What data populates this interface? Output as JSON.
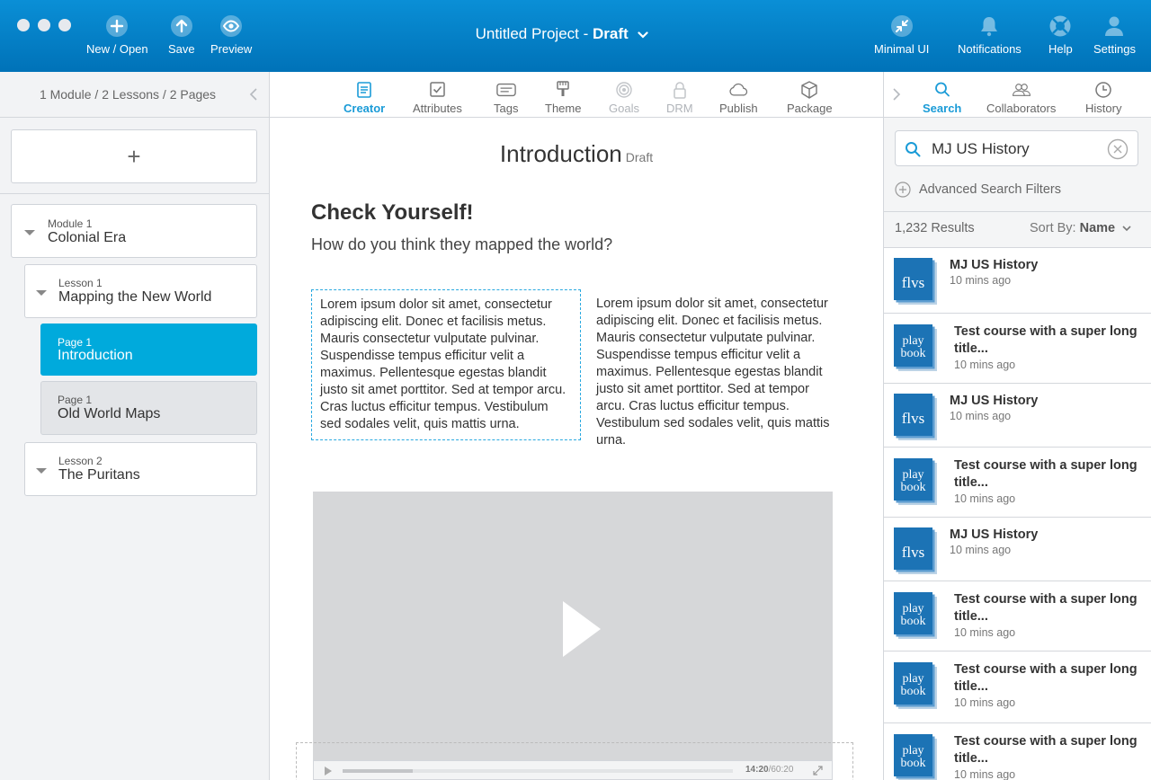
{
  "window": {
    "controls": [
      "close",
      "minimize",
      "maximize"
    ]
  },
  "toolbar": {
    "new_open": "New / Open",
    "save": "Save",
    "preview": "Preview",
    "project_name": "Untitled Project - ",
    "project_status": "Draft",
    "minimal_ui": "Minimal UI",
    "notifications": "Notifications",
    "help": "Help",
    "settings": "Settings"
  },
  "outline": {
    "summary": "1 Module / 2 Lessons / 2 Pages",
    "add_symbol": "+",
    "items": [
      {
        "sub": "Module 1",
        "title": "Colonial Era"
      },
      {
        "sub": "Lesson 1",
        "title": "Mapping the New World"
      },
      {
        "sub": "Page 1",
        "title": "Introduction"
      },
      {
        "sub": "Page 1",
        "title": "Old World Maps"
      },
      {
        "sub": "Lesson 2",
        "title": "The Puritans"
      }
    ]
  },
  "tabs": [
    {
      "label": "Creator",
      "icon": "creator-icon",
      "state": "active"
    },
    {
      "label": "Attributes",
      "icon": "checkbox-icon",
      "state": "normal"
    },
    {
      "label": "Tags",
      "icon": "tags-icon",
      "state": "normal"
    },
    {
      "label": "Theme",
      "icon": "paintbrush-icon",
      "state": "normal"
    },
    {
      "label": "Goals",
      "icon": "target-icon",
      "state": "disabled"
    },
    {
      "label": "DRM",
      "icon": "lock-icon",
      "state": "disabled"
    },
    {
      "label": "Publish",
      "icon": "cloud-icon",
      "state": "normal"
    },
    {
      "label": "Package",
      "icon": "box-icon",
      "state": "normal"
    }
  ],
  "editor": {
    "page_title": "Introduction",
    "page_status": "Draft",
    "heading": "Check Yourself!",
    "question": "How do you think they mapped the world?",
    "col1": "Lorem ipsum dolor sit amet, consectetur adipiscing elit. Donec et facilisis metus. Mauris consectetur vulputate pulvinar. Suspendisse tempus efficitur velit a maximus. Pellentesque egestas blandit justo sit amet porttitor. Sed at tempor arcu. Cras luctus efficitur tempus. Vestibulum sed sodales velit, quis mattis urna.",
    "col2": "Lorem ipsum dolor sit amet, consectetur adipiscing elit. Donec et facilisis metus. Mauris consectetur vulputate pulvinar. Suspendisse tempus efficitur velit a maximus. Pellentesque egestas blandit justo sit amet porttitor. Sed at tempor arcu. Cras luctus efficitur tempus. Vestibulum sed sodales velit, quis mattis urna.",
    "video": {
      "current": "14:20",
      "total": "/60:20",
      "progress": 0.18
    }
  },
  "right_tabs": [
    {
      "label": "Search",
      "icon": "search-icon",
      "state": "active"
    },
    {
      "label": "Collaborators",
      "icon": "people-icon",
      "state": "normal"
    },
    {
      "label": "History",
      "icon": "clock-icon",
      "state": "normal"
    }
  ],
  "search": {
    "value": "MJ US History",
    "advanced": "Advanced Search Filters",
    "results_count": "1,232 Results",
    "sort_label": "Sort By:",
    "sort_value": "Name"
  },
  "results": [
    {
      "title": "MJ US History",
      "time": "10 mins ago",
      "logo": "flvs"
    },
    {
      "title": "Test course with a super long title...",
      "time": "10 mins ago",
      "logo": "playbook"
    },
    {
      "title": "MJ US History",
      "time": "10 mins ago",
      "logo": "flvs"
    },
    {
      "title": "Test course with a super long title...",
      "time": "10 mins ago",
      "logo": "playbook"
    },
    {
      "title": "MJ US History",
      "time": "10 mins ago",
      "logo": "flvs"
    },
    {
      "title": "Test course with a super long title...",
      "time": "10 mins ago",
      "logo": "playbook"
    },
    {
      "title": "Test course with a super long title...",
      "time": "10 mins ago",
      "logo": "playbook"
    },
    {
      "title": "Test course with a super long title...",
      "time": "10 mins ago",
      "logo": "playbook"
    }
  ],
  "logo_text": {
    "flvs": "flvs",
    "play": "play",
    "book": "book"
  },
  "colors": {
    "brand_blue": "#0a8fd6",
    "active_cyan": "#00aadc",
    "tab_active": "#1a9bd7"
  }
}
